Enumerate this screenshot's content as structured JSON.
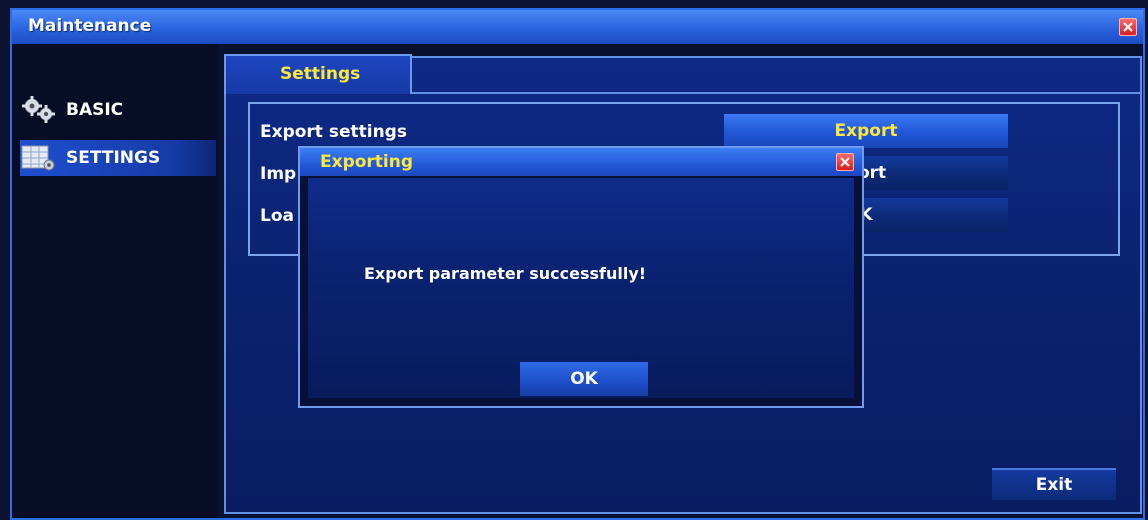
{
  "window": {
    "title": "Maintenance"
  },
  "sidebar": {
    "items": [
      {
        "label": "BASIC",
        "icon": "gears-icon",
        "active": false
      },
      {
        "label": "SETTINGS",
        "icon": "settings-grid-icon",
        "active": true
      }
    ]
  },
  "tab": {
    "label": "Settings"
  },
  "settings": {
    "rows": [
      {
        "label": "Export settings",
        "button": "Export"
      },
      {
        "label": "Imp",
        "button": "port"
      },
      {
        "label": "Loa",
        "button": "K"
      }
    ]
  },
  "dialog": {
    "title": "Exporting",
    "message": "Export parameter successfully!",
    "ok_label": "OK"
  },
  "footer": {
    "exit_label": "Exit"
  },
  "colors": {
    "titlebar": "#2a63df",
    "accent_text": "#ffe73a",
    "close": "#d81e1e",
    "background": "#08112e"
  }
}
